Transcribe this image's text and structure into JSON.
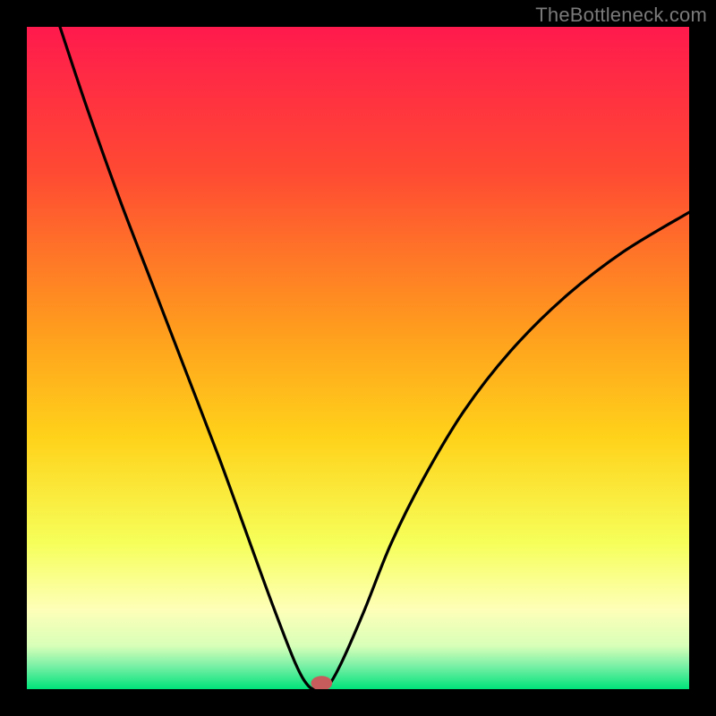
{
  "watermark": "TheBottleneck.com",
  "chart_data": {
    "type": "line",
    "title": "",
    "xlabel": "",
    "ylabel": "",
    "xlim": [
      0,
      100
    ],
    "ylim": [
      0,
      100
    ],
    "grid": false,
    "legend": false,
    "background_gradient_stops": [
      {
        "offset": 0.0,
        "color": "#ff1a4d"
      },
      {
        "offset": 0.22,
        "color": "#ff4a33"
      },
      {
        "offset": 0.45,
        "color": "#ff9a1e"
      },
      {
        "offset": 0.62,
        "color": "#ffd21a"
      },
      {
        "offset": 0.78,
        "color": "#f6ff5a"
      },
      {
        "offset": 0.88,
        "color": "#feffb8"
      },
      {
        "offset": 0.935,
        "color": "#d8ffb8"
      },
      {
        "offset": 0.965,
        "color": "#7af0a6"
      },
      {
        "offset": 1.0,
        "color": "#00e37a"
      }
    ],
    "series": [
      {
        "name": "bottleneck-curve",
        "color": "#000000",
        "x": [
          5,
          9,
          14,
          19,
          24,
          29,
          33,
          37,
          40.5,
          42.5,
          44,
          45.5,
          47.5,
          51,
          55,
          60,
          66,
          73,
          81,
          90,
          100
        ],
        "y": [
          100,
          88,
          74,
          61,
          48,
          35,
          24,
          13,
          4,
          0.5,
          0,
          0.5,
          4,
          12,
          22,
          32,
          42,
          51,
          59,
          66,
          72
        ]
      }
    ],
    "marker": {
      "name": "bottleneck-marker",
      "x": 44.5,
      "y": 0.9,
      "rx": 1.6,
      "ry": 1.1,
      "fill": "#c75c5c"
    }
  }
}
